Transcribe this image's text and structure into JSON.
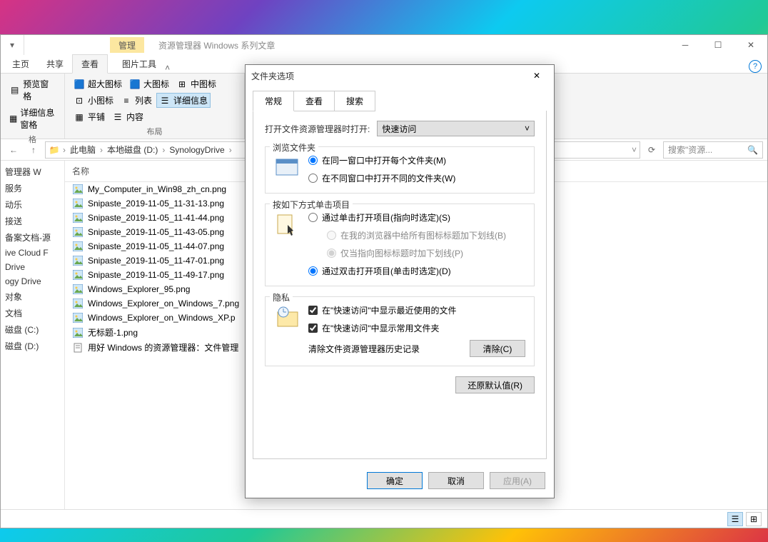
{
  "window": {
    "context_tab": "管理",
    "title": "资源管理器 Windows 系列文章",
    "ribbon_tabs": {
      "home": "主页",
      "share": "共享",
      "view": "查看",
      "picture": "图片工具"
    },
    "panes": {
      "preview": "预览窗格",
      "details_pane": "详细信息窗格",
      "nav_label": "格"
    },
    "layout": {
      "xl": "超大图标",
      "lg": "大图标",
      "md": "中图标",
      "sm": "小图标",
      "list": "列表",
      "details": "详细信息",
      "tiles": "平铺",
      "content": "内容",
      "label": "布局"
    }
  },
  "breadcrumb": {
    "pc": "此电脑",
    "drive": "本地磁盘 (D:)",
    "folder": "SynologyDrive"
  },
  "search": {
    "placeholder": "搜索\"资源..."
  },
  "nav_pane": [
    "管理器 W",
    "服务",
    "动乐",
    "接送",
    "备案文档-源",
    "ive Cloud F",
    "Drive",
    "ogy Drive",
    "对象",
    "文档",
    "磁盘 (C:)",
    "磁盘 (D:)"
  ],
  "column_header": "名称",
  "files": [
    "My_Computer_in_Win98_zh_cn.png",
    "Snipaste_2019-11-05_11-31-13.png",
    "Snipaste_2019-11-05_11-41-44.png",
    "Snipaste_2019-11-05_11-43-05.png",
    "Snipaste_2019-11-05_11-44-07.png",
    "Snipaste_2019-11-05_11-47-01.png",
    "Snipaste_2019-11-05_11-49-17.png",
    "Windows_Explorer_95.png",
    "Windows_Explorer_on_Windows_7.png",
    "Windows_Explorer_on_Windows_XP.p",
    "无标题-1.png",
    "用好 Windows 的资源管理器：文件管理"
  ],
  "dialog": {
    "title": "文件夹选项",
    "tabs": {
      "general": "常规",
      "view": "查看",
      "search": "搜索"
    },
    "open_label": "打开文件资源管理器时打开:",
    "open_value": "快速访问",
    "browse": {
      "legend": "浏览文件夹",
      "same": "在同一窗口中打开每个文件夹(M)",
      "own": "在不同窗口中打开不同的文件夹(W)"
    },
    "click": {
      "legend": "按如下方式单击项目",
      "single": "通过单击打开项目(指向时选定)(S)",
      "underline_all": "在我的浏览器中给所有图标标题加下划线(B)",
      "underline_point": "仅当指向图标标题时加下划线(P)",
      "double": "通过双击打开项目(单击时选定)(D)"
    },
    "privacy": {
      "legend": "隐私",
      "recent": "在\"快速访问\"中显示最近使用的文件",
      "frequent": "在\"快速访问\"中显示常用文件夹",
      "clear_label": "清除文件资源管理器历史记录",
      "clear_btn": "清除(C)"
    },
    "restore": "还原默认值(R)",
    "ok": "确定",
    "cancel": "取消",
    "apply": "应用(A)"
  }
}
